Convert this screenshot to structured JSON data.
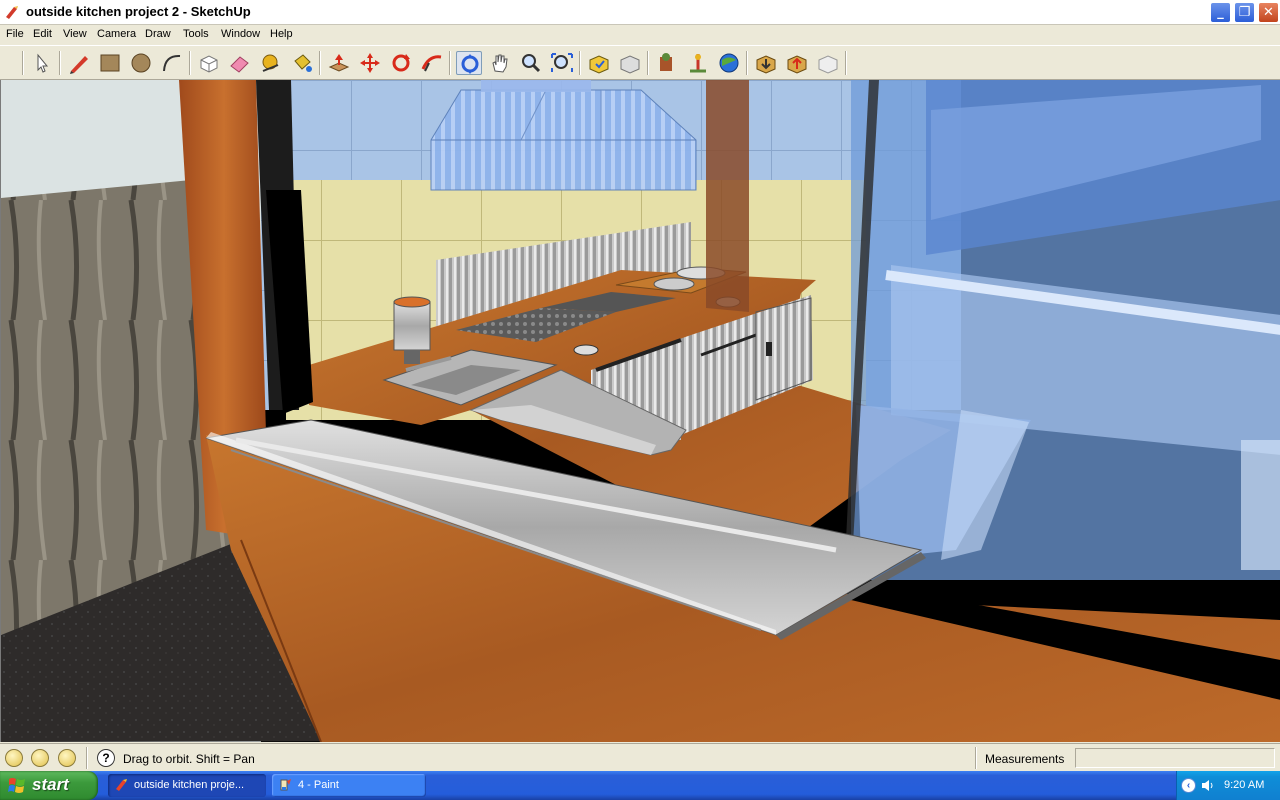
{
  "window": {
    "title": "outside kitchen project 2 - SketchUp"
  },
  "menu": {
    "items": [
      "File",
      "Edit",
      "View",
      "Camera",
      "Draw",
      "Tools",
      "Window",
      "Help"
    ]
  },
  "toolbar": {
    "tools": [
      "select",
      "pencil",
      "rectangle",
      "circle",
      "arc",
      "make-component",
      "eraser",
      "tape-measure",
      "paint-bucket",
      "push-pull",
      "move",
      "rotate",
      "follow-me",
      "orbit",
      "pan",
      "zoom",
      "zoom-extents",
      "get-models",
      "share-model",
      "components",
      "place-model",
      "google-earth",
      "get-current-view",
      "toggle-terrain",
      "add-location"
    ],
    "active_tool": "orbit"
  },
  "status": {
    "hint": "Drag to orbit.  Shift = Pan",
    "measurements_label": "Measurements",
    "measurements_value": "",
    "help_glyph": "?"
  },
  "taskbar": {
    "start_label": "start",
    "tasks": [
      {
        "label": "outside kitchen proje...",
        "icon": "sketchup-icon",
        "active": true
      },
      {
        "label": "4 - Paint",
        "icon": "paint-icon",
        "active": false
      }
    ],
    "clock": "9:20 AM"
  },
  "colors": {
    "accent": "#2a5fd8",
    "wood": "#b86a2a",
    "glass": "#6f9bd8",
    "steel": "#c8c8c8"
  }
}
